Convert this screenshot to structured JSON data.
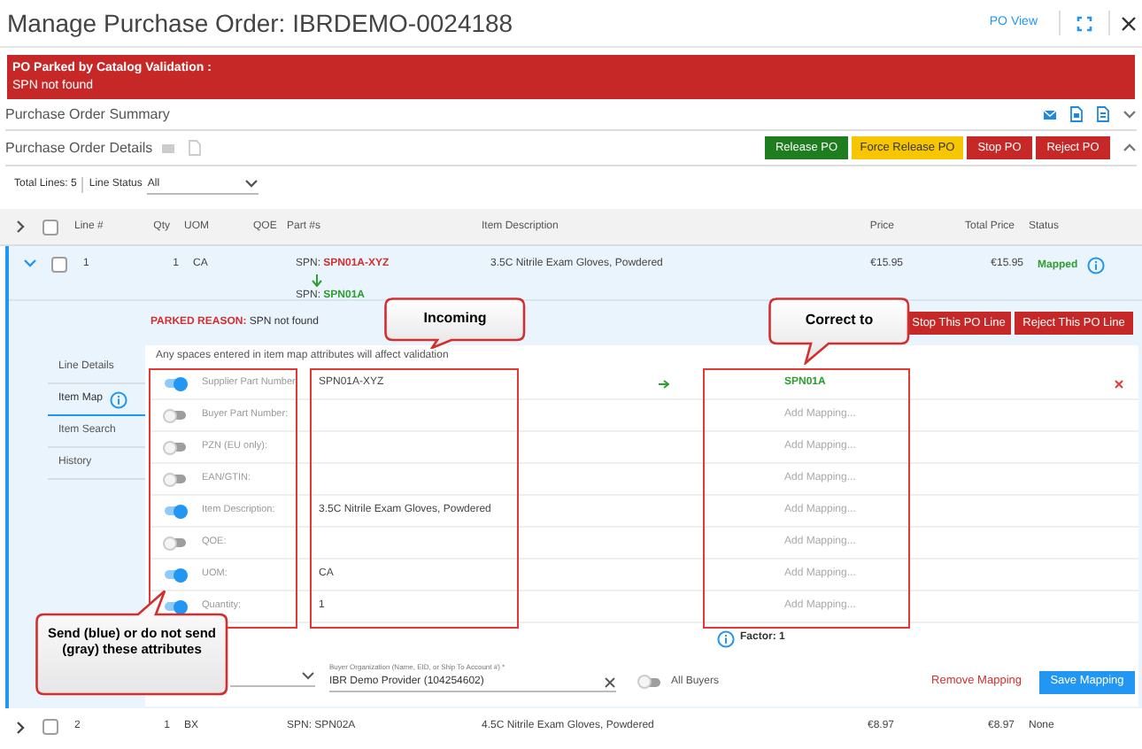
{
  "window": {
    "title": "Manage Purchase Order: IBRDEMO-0024188",
    "po_view": "PO View"
  },
  "banner": {
    "title": "PO Parked by Catalog Validation :",
    "message": "SPN not found"
  },
  "summary": {
    "title": "Purchase Order Summary",
    "expanded": false
  },
  "details": {
    "title": "Purchase Order Details",
    "expanded": true,
    "buttons": [
      {
        "label": "Release PO",
        "kind": "release"
      },
      {
        "label": "Force Release PO",
        "kind": "force"
      },
      {
        "label": "Stop PO",
        "kind": "stop"
      },
      {
        "label": "Reject PO",
        "kind": "reject"
      }
    ]
  },
  "filters": {
    "total_lines": "Total Lines: 5",
    "line_status_label": "Line Status",
    "line_status_value": "All"
  },
  "table": {
    "select_all": {
      "checked": false
    },
    "columns": [
      "Line #",
      "Qty",
      "UOM",
      "QOE",
      "Part #s",
      "Item Description",
      "Price",
      "Total Price",
      "Status"
    ],
    "rows": [
      {
        "expanded": true,
        "checked": false,
        "line": "1",
        "qty": "1",
        "uom": "CA",
        "parts": [
          {
            "label": "SPN:",
            "value": "SPN01A-XYZ",
            "kind": "incoming"
          },
          {
            "label": "SPN:",
            "value": "SPN01A",
            "kind": "corrected"
          }
        ],
        "description": "3.5C Nitrile Exam Gloves, Powdered",
        "price": "€15.95",
        "total": "€15.95",
        "status": "Mapped",
        "color": "#2e9e2e",
        "info": true
      },
      {
        "expanded": false,
        "checked": false,
        "line": "2",
        "qty": "1",
        "uom": "BX",
        "parts": [
          {
            "label": "SPN:",
            "value": "SPN02A",
            "kind": "plain"
          }
        ],
        "description": "4.5C Nitrile Exam Gloves, Powdered",
        "price": "€8.97",
        "total": "€8.97",
        "status": "None",
        "color": "#444444",
        "info": false
      }
    ]
  },
  "line_detail": {
    "parked_label": "PARKED REASON:",
    "parked_text": "SPN not found",
    "buttons": [
      "Stop This PO Line",
      "Reject This PO Line"
    ],
    "tabs": [
      {
        "label": "Line Details",
        "selected": false
      },
      {
        "label": "Item Map",
        "selected": true
      },
      {
        "label": "Item Search",
        "selected": false
      },
      {
        "label": "History",
        "selected": false
      }
    ],
    "note": "Any spaces entered in item map attributes will affect validation",
    "attributes": [
      {
        "label": "Supplier Part Number:",
        "on": true,
        "incoming": "SPN01A-XYZ",
        "mapping": "SPN01A"
      },
      {
        "label": "Buyer Part Number:",
        "on": false,
        "placeholder": "Add Mapping..."
      },
      {
        "label": "PZN (EU only):",
        "on": false,
        "placeholder": "Add Mapping..."
      },
      {
        "label": "EAN/GTIN:",
        "on": false,
        "placeholder": "Add Mapping..."
      },
      {
        "label": "Item Description:",
        "on": true,
        "incoming": "3.5C Nitrile Exam Gloves, Powdered",
        "placeholder": "Add Mapping..."
      },
      {
        "label": "QOE:",
        "on": false,
        "placeholder": "Add Mapping..."
      },
      {
        "label": "UOM:",
        "on": true,
        "incoming": "CA",
        "placeholder": "Add Mapping..."
      },
      {
        "label": "Quantity:",
        "on": true,
        "incoming": "1",
        "placeholder": "Add Mapping..."
      }
    ],
    "factor": "Factor: 1",
    "buyer_org": {
      "label": "Buyer Organization (Name, EID, or Ship To Account #) *",
      "value": "IBR Demo Provider (104254602)"
    },
    "all_buyers": {
      "label": "All Buyers",
      "on": false
    },
    "remove": "Remove Mapping",
    "save": "Save Mapping"
  },
  "annotations": [
    {
      "text": "Incoming"
    },
    {
      "text": "Correct to"
    },
    {
      "text": "Send (blue) or do not send (gray) these attributes"
    }
  ]
}
